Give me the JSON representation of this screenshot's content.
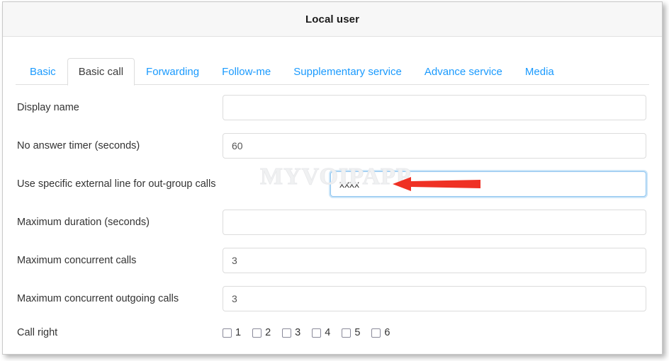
{
  "window": {
    "title": "Local user"
  },
  "tabs": [
    {
      "label": "Basic",
      "active": false
    },
    {
      "label": "Basic call",
      "active": true
    },
    {
      "label": "Forwarding",
      "active": false
    },
    {
      "label": "Follow-me",
      "active": false
    },
    {
      "label": "Supplementary service",
      "active": false
    },
    {
      "label": "Advance service",
      "active": false
    },
    {
      "label": "Media",
      "active": false
    }
  ],
  "form": {
    "rows": [
      {
        "label": "Display name",
        "value": "",
        "placeholder": ""
      },
      {
        "label": "No answer timer (seconds)",
        "value": "60",
        "placeholder": ""
      },
      {
        "label": "Use specific external line for out-group calls",
        "value": "xxxx",
        "placeholder": ""
      },
      {
        "label": "Maximum duration (seconds)",
        "value": "",
        "placeholder": ""
      },
      {
        "label": "Maximum concurrent calls",
        "value": "3",
        "placeholder": ""
      },
      {
        "label": "Maximum concurrent outgoing calls",
        "value": "3",
        "placeholder": ""
      }
    ],
    "call_right": {
      "label": "Call right",
      "options": [
        {
          "label": "1",
          "checked": false
        },
        {
          "label": "2",
          "checked": false
        },
        {
          "label": "3",
          "checked": false
        },
        {
          "label": "4",
          "checked": false
        },
        {
          "label": "5",
          "checked": false
        },
        {
          "label": "6",
          "checked": false
        }
      ]
    }
  },
  "watermark": {
    "text": "MYVOIPAPP"
  },
  "annotation": {
    "arrow_color": "#ef3124",
    "direction": "left"
  },
  "colors": {
    "tab_link": "#1a9afe",
    "tab_active_text": "#3c3c3c",
    "header_bg": "#f7f7f7",
    "focus_border": "#8fc5f0"
  }
}
